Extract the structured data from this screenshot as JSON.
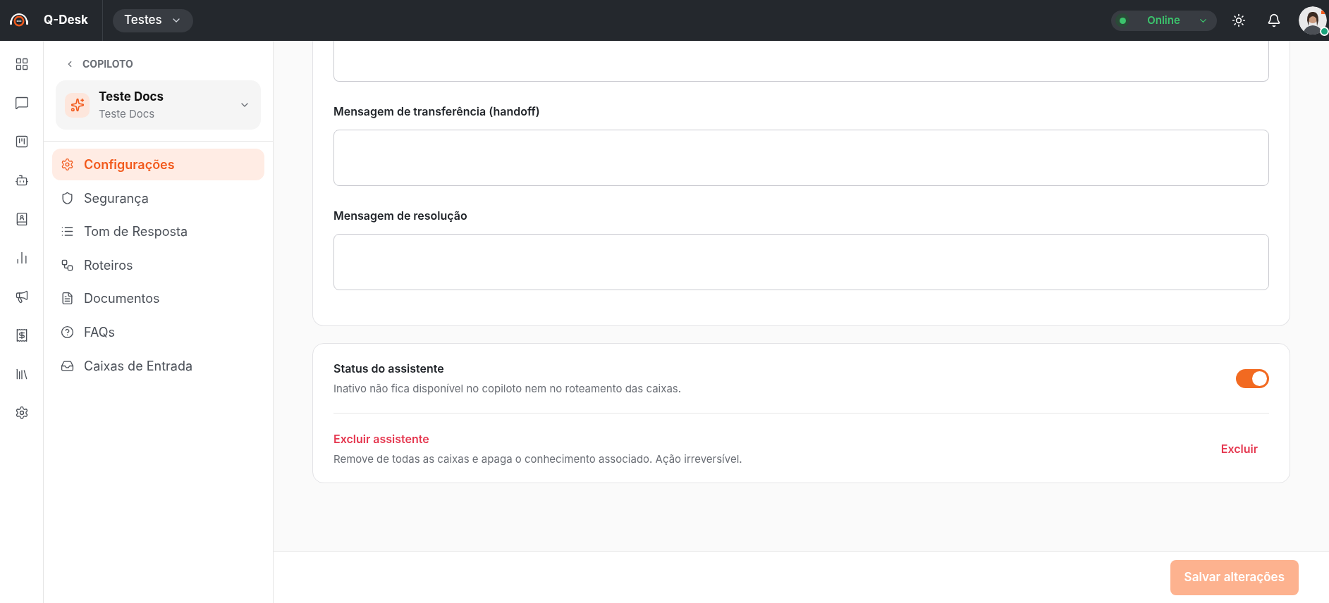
{
  "app": {
    "name": "Q-Desk"
  },
  "workspace": {
    "label": "Testes"
  },
  "presence": {
    "label": "Online"
  },
  "nav": {
    "back": "COPILOTO",
    "assistant": {
      "name": "Teste Docs",
      "subtitle": "Teste Docs"
    },
    "items": [
      {
        "label": "Configurações",
        "selected": true
      },
      {
        "label": "Segurança",
        "selected": false
      },
      {
        "label": "Tom de Resposta",
        "selected": false
      },
      {
        "label": "Roteiros",
        "selected": false
      },
      {
        "label": "Documentos",
        "selected": false
      },
      {
        "label": "FAQs",
        "selected": false
      },
      {
        "label": "Caixas de Entrada",
        "selected": false
      }
    ]
  },
  "form": {
    "fields": [
      {
        "label": "Mensagem de transferência (handoff)"
      },
      {
        "label": "Mensagem de resolução"
      }
    ]
  },
  "status_card": {
    "title": "Status do assistente",
    "description": "Inativo não fica disponível no copiloto nem no roteamento das caixas.",
    "on": true
  },
  "danger": {
    "title": "Excluir assistente",
    "description": "Remove de todas as caixas e apaga o conhecimento associado. Ação irreversível.",
    "action": "Excluir"
  },
  "footer": {
    "save": {
      "label": "Salvar alterações",
      "disabled": true
    }
  }
}
